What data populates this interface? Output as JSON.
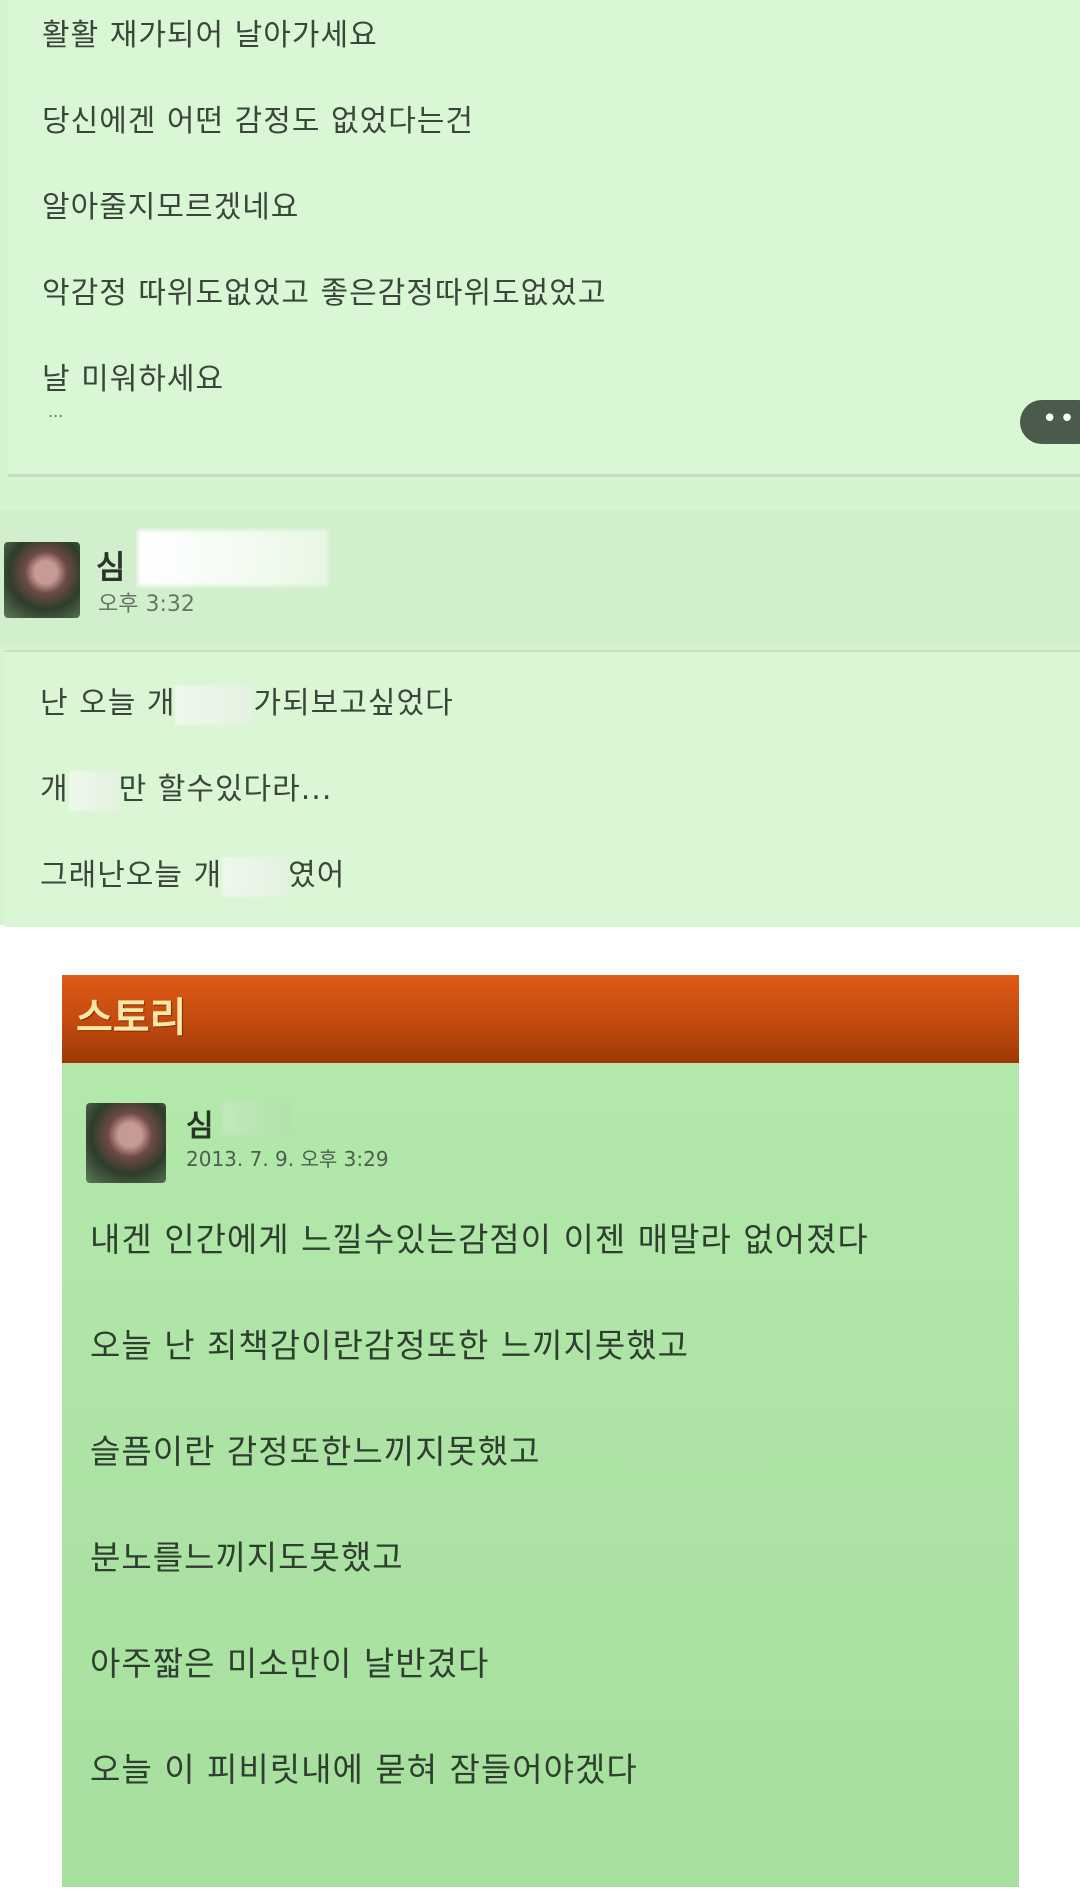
{
  "post": {
    "lines": [
      "활활 재가되어 날아가세요",
      "당신에겐 어떤 감정도 없었다는건",
      "알아줄지모르겠네요",
      "악감정 따위도없었고 좋은감정따위도없었고",
      "날 미워하세요"
    ],
    "ellipsis": "...",
    "more_label": "•••"
  },
  "comment": {
    "author": "심",
    "time": "오후 3:32",
    "lines": [
      {
        "before": "난 오늘 개",
        "after": "가되보고싶었다"
      },
      {
        "before": "개",
        "after": "만 할수있다라..."
      },
      {
        "before": "그래난오늘 개",
        "after": "였어"
      }
    ]
  },
  "story": {
    "header": "스토리",
    "author": "심",
    "date": "2013. 7. 9. 오후 3:29",
    "lines": [
      "내겐 인간에게 느낄수있는감점이 이젠 매말라 없어졌다",
      "오늘 난 죄책감이란감정또한 느끼지못했고",
      "슬픔이란 감정또한느끼지못했고",
      "분노를느끼지도못했고",
      "아주짧은 미소만이 날반겼다",
      "오늘 이 피비릿내에 묻혀 잠들어야겠다"
    ]
  }
}
